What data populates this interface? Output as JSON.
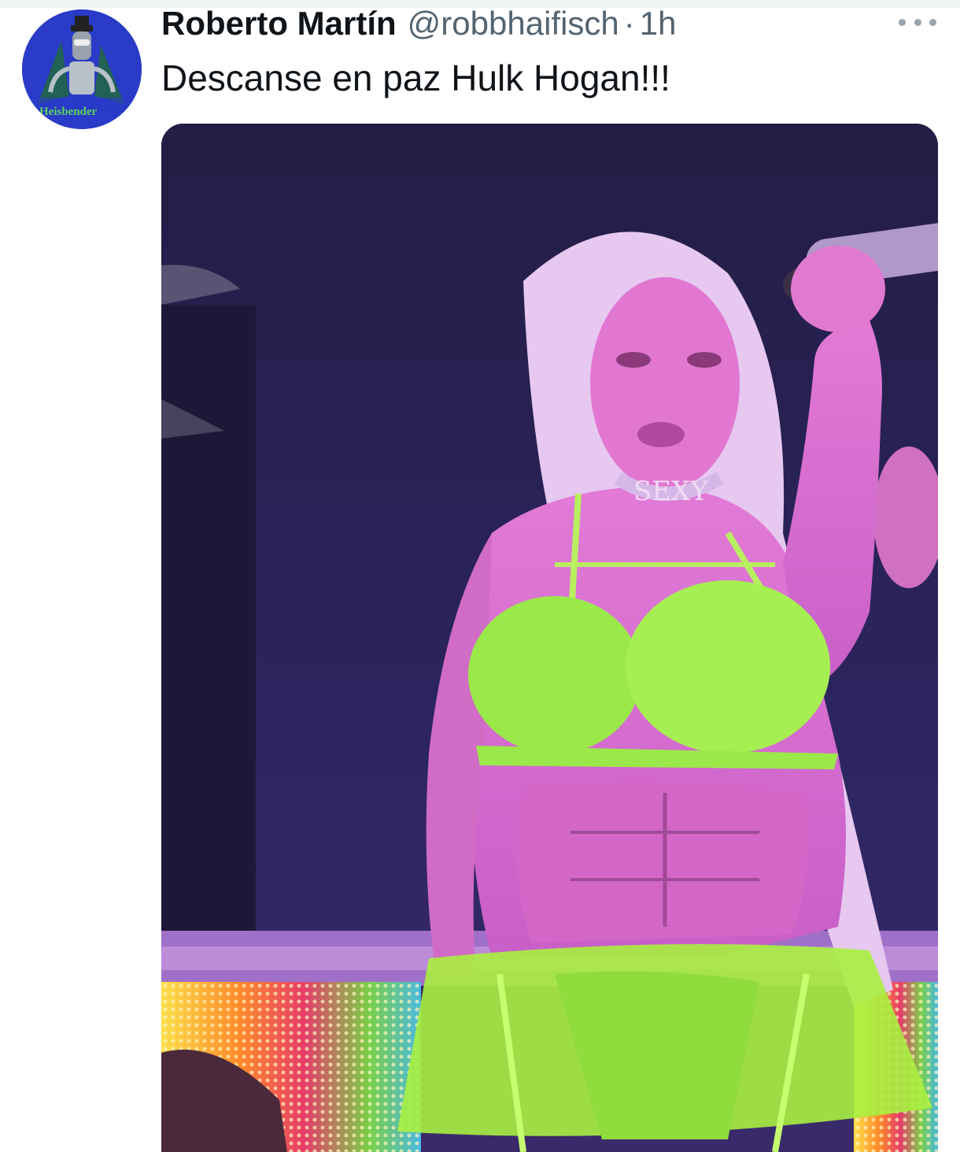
{
  "tweet": {
    "author": {
      "display_name": "Roberto Martín",
      "handle": "@robbhaifisch",
      "separator": "·",
      "time": "1h",
      "avatar_text": "Heisbender"
    },
    "text": "Descanse en paz Hulk Hogan!!!",
    "more_icon": "more-horizontal-icon",
    "media": {
      "necklace_text": "SEXY"
    }
  },
  "colors": {
    "avatar_bg": "#2a3bc8",
    "name": "#0f1419",
    "secondary": "#536471",
    "stage_bg": "#2a2352",
    "neon_green": "#9be84a"
  }
}
